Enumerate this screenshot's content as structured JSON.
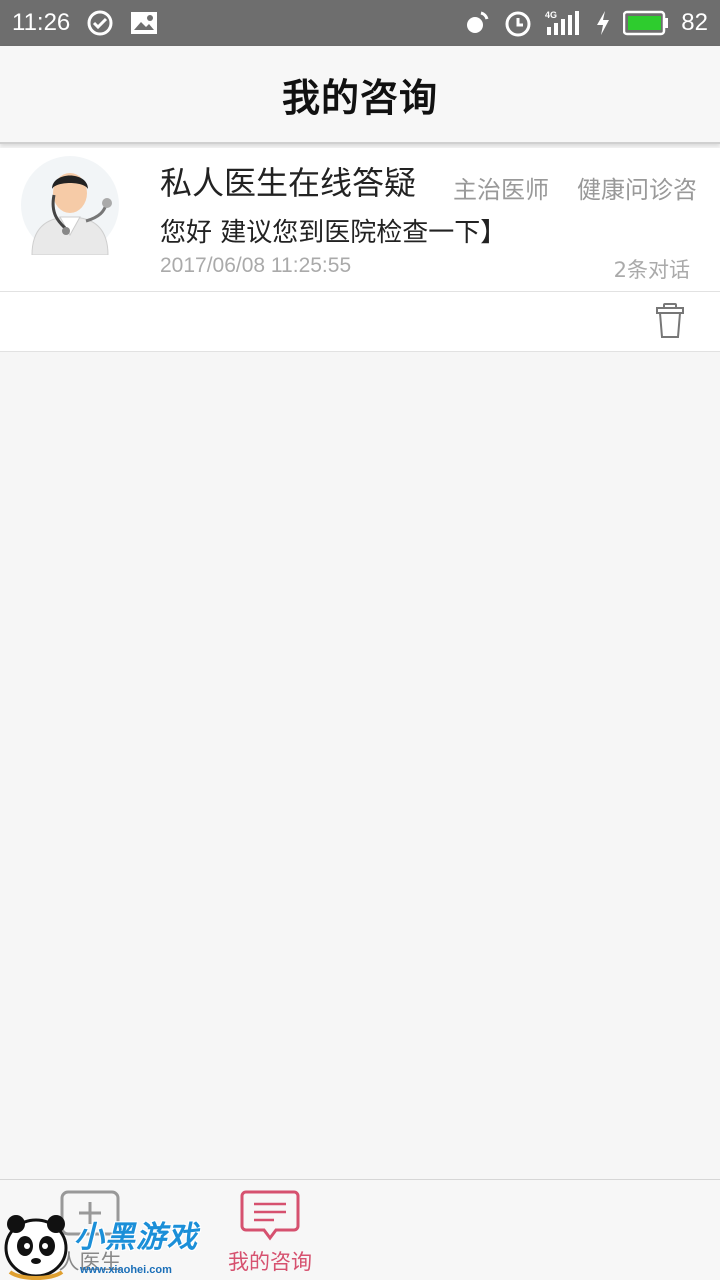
{
  "status_bar": {
    "time": "11:26",
    "network": "4G",
    "battery": "82",
    "battery_color": "#2ecc2e"
  },
  "header": {
    "title": "我的咨询"
  },
  "consultation": {
    "doctor_name": "私人医生在线答疑",
    "doctor_title": "主治医师",
    "consult_type": "健康问诊咨",
    "last_message": "您好  建议您到医院检查一下】",
    "timestamp": "2017/06/08 11:25:55",
    "dialog_count": "2条对话"
  },
  "bottom_nav": {
    "tabs": [
      {
        "label": "人医生",
        "icon": "add-icon",
        "active": false
      },
      {
        "label": "我的咨询",
        "icon": "chat-icon",
        "active": true
      }
    ],
    "active_color": "#d6516f"
  },
  "watermark": {
    "text": "小黑游戏",
    "url": "www.xiaohei.com"
  }
}
